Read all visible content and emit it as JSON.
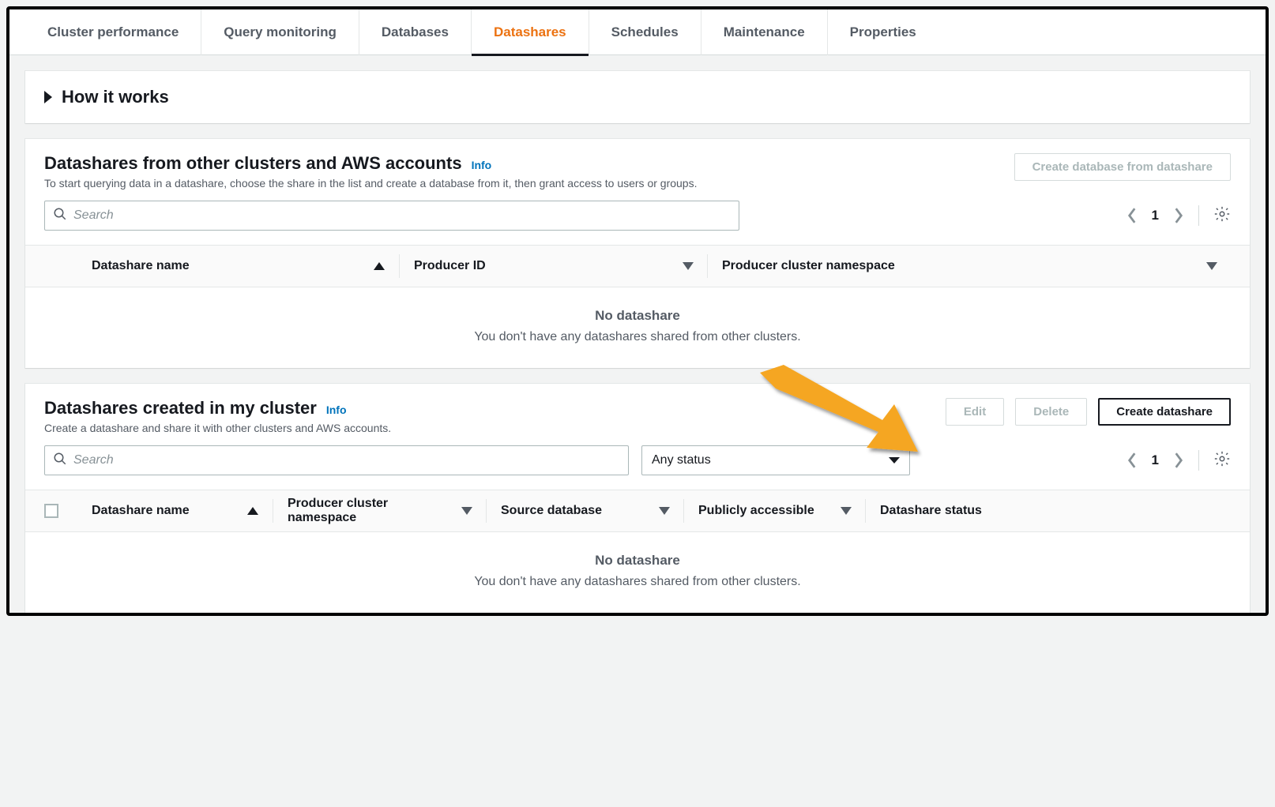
{
  "tabs": {
    "items": [
      {
        "label": "Cluster performance",
        "active": false
      },
      {
        "label": "Query monitoring",
        "active": false
      },
      {
        "label": "Databases",
        "active": false
      },
      {
        "label": "Datashares",
        "active": true
      },
      {
        "label": "Schedules",
        "active": false
      },
      {
        "label": "Maintenance",
        "active": false
      },
      {
        "label": "Properties",
        "active": false
      }
    ]
  },
  "how_it_works": {
    "title": "How it works"
  },
  "section1": {
    "title": "Datashares from other clusters and AWS accounts",
    "info": "Info",
    "desc": "To start querying data in a datashare, choose the share in the list and create a database from it, then grant access to users or groups.",
    "button": "Create database from datashare",
    "search_placeholder": "Search",
    "page": "1",
    "columns": {
      "c1": "Datashare name",
      "c2": "Producer ID",
      "c3": "Producer cluster namespace"
    },
    "empty_title": "No datashare",
    "empty_desc": "You don't have any datashares shared from other clusters."
  },
  "section2": {
    "title": "Datashares created in my cluster",
    "info": "Info",
    "desc": "Create a datashare and share it with other clusters and AWS accounts.",
    "buttons": {
      "edit": "Edit",
      "delete": "Delete",
      "create": "Create datashare"
    },
    "search_placeholder": "Search",
    "status_select": "Any status",
    "page": "1",
    "columns": {
      "c1": "Datashare name",
      "c2": "Producer cluster namespace",
      "c3": "Source database",
      "c4": "Publicly accessible",
      "c5": "Datashare status"
    },
    "empty_title": "No datashare",
    "empty_desc": "You don't have any datashares shared from other clusters."
  }
}
